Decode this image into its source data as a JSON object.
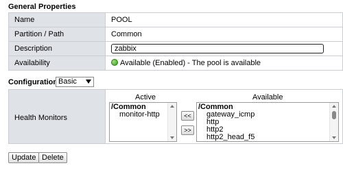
{
  "general": {
    "title": "General Properties",
    "rows": [
      {
        "label": "Name",
        "value": "POOL"
      },
      {
        "label": "Partition / Path",
        "value": "Common"
      },
      {
        "label": "Description",
        "value": "zabbix"
      },
      {
        "label": "Availability",
        "value": "Available (Enabled) - The pool is available"
      }
    ]
  },
  "configuration": {
    "label": "Configuration:",
    "selected": "Basic"
  },
  "health_monitors": {
    "label": "Health Monitors",
    "active_header": "Active",
    "available_header": "Available",
    "active_group": "/Common",
    "active_items": [
      "monitor-http"
    ],
    "available_group": "/Common",
    "available_items": [
      "gateway_icmp",
      "http",
      "http2",
      "http2_head_f5"
    ],
    "add_label": "<<",
    "remove_label": ">>"
  },
  "buttons": {
    "update": "Update",
    "delete": "Delete"
  },
  "colors": {
    "label_bg": "#dfe3e8",
    "border": "#c9ccd0",
    "status_green": "#3a9a22"
  }
}
